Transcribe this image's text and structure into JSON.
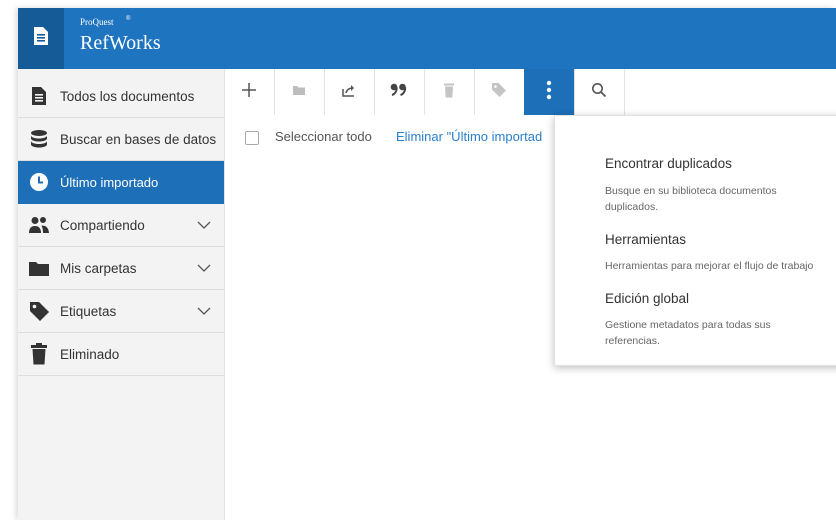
{
  "header": {
    "brand_small": "ProQuest",
    "brand_name": "RefWorks"
  },
  "sidebar": {
    "items": [
      {
        "label": "Todos los documentos",
        "icon": "document-icon"
      },
      {
        "label": "Buscar en bases de datos",
        "icon": "database-icon"
      },
      {
        "label": "Último importado",
        "icon": "clock-icon"
      },
      {
        "label": "Compartiendo",
        "icon": "people-icon"
      },
      {
        "label": "Mis carpetas",
        "icon": "folder-icon"
      },
      {
        "label": "Etiquetas",
        "icon": "tag-icon"
      },
      {
        "label": "Eliminado",
        "icon": "trash-icon"
      }
    ]
  },
  "toolbar": {
    "icons": [
      "plus-icon",
      "folder-icon",
      "share-icon",
      "quote-icon",
      "trash-icon",
      "tag-icon",
      "more-vertical-icon",
      "search-icon"
    ]
  },
  "content": {
    "select_all": "Seleccionar todo",
    "remove_link": "Eliminar \"Último importad"
  },
  "menu": {
    "items": [
      {
        "title": "Encontrar duplicados",
        "desc_lines": [
          "Busque en su biblioteca documentos",
          "duplicados."
        ]
      },
      {
        "title": "Herramientas",
        "desc_lines": [
          "Herramientas para mejorar el flujo de trabajo"
        ]
      },
      {
        "title": "Edición global",
        "desc_lines": [
          "Gestione metadatos para todas sus",
          "referencias."
        ]
      }
    ]
  },
  "colors": {
    "header_blue": "#1f74c0",
    "active_blue": "#1d6fb8",
    "link_blue": "#2a7fcc"
  }
}
